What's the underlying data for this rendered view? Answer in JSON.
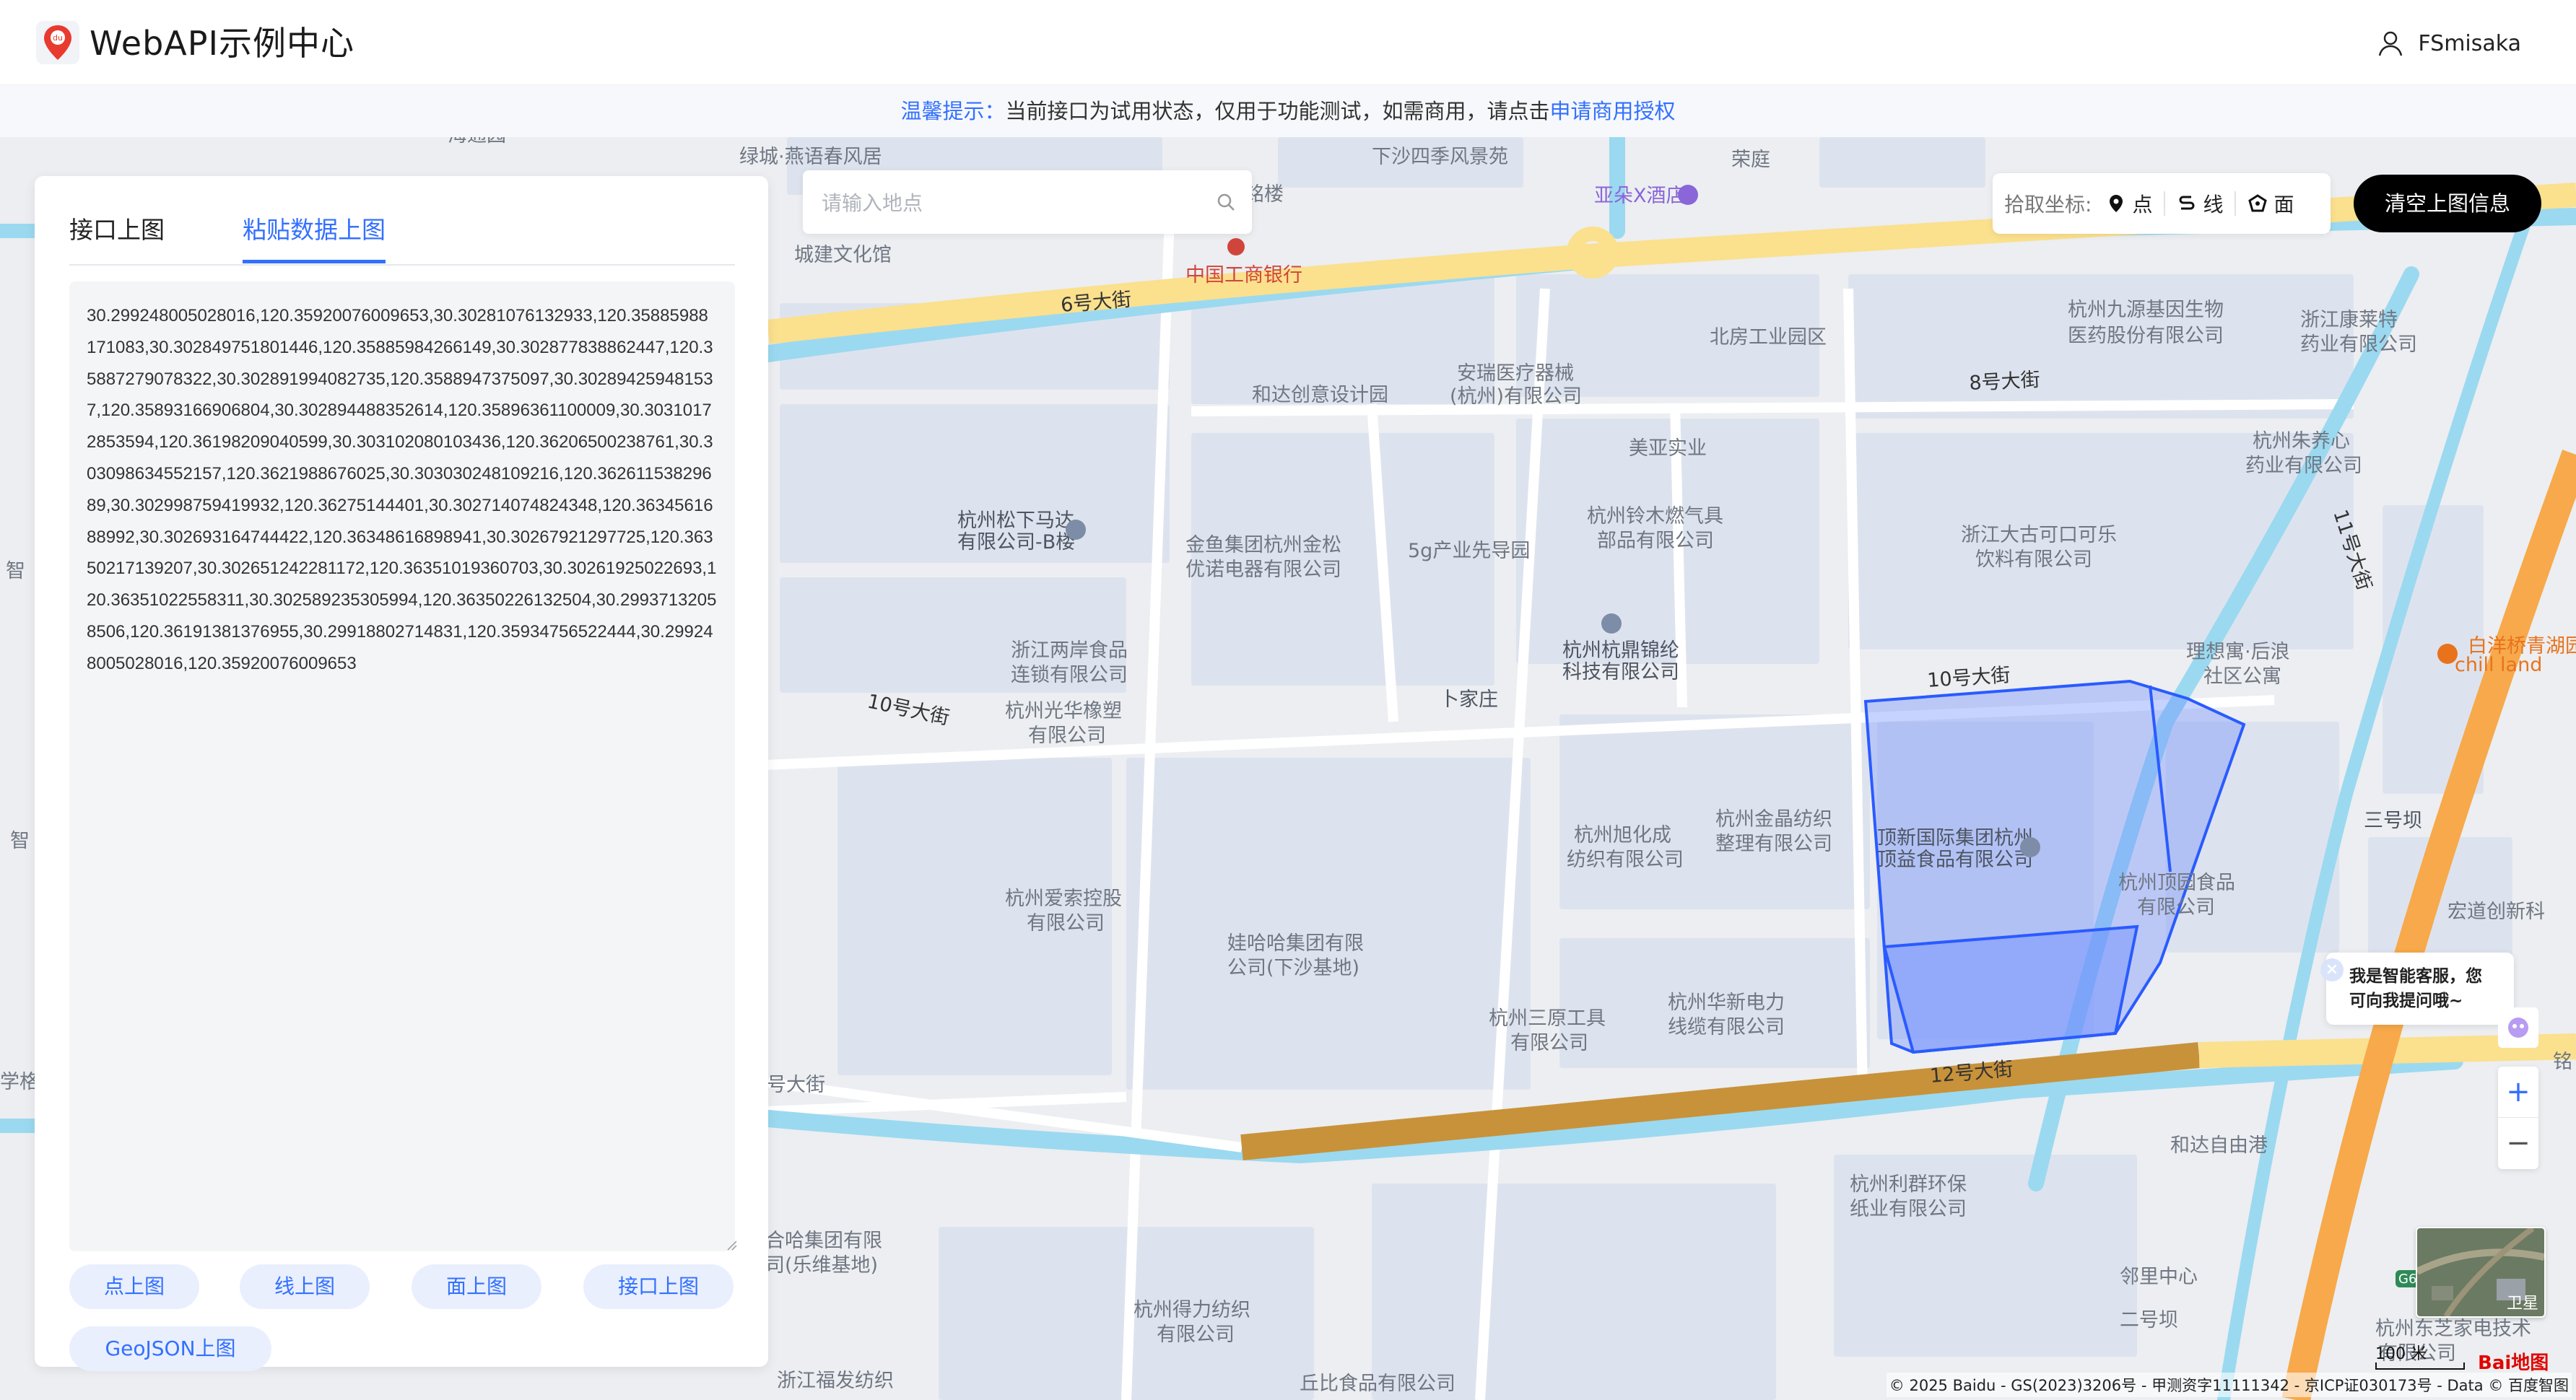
{
  "header": {
    "app_title": "WebAPI示例中心",
    "username": "FSmisaka"
  },
  "notice": {
    "tip_label": "温馨提示：",
    "text": "当前接口为试用状态，仅用于功能测试，如需商用，请点击",
    "link": "申请商用授权"
  },
  "panel": {
    "tabs": [
      "接口上图",
      "粘贴数据上图"
    ],
    "active_tab": "粘贴数据上图",
    "textarea_value": "30.299248005028016,120.35920076009653,30.30281076132933,120.35885988171083,30.302849751801446,120.35885984266149,30.302877838862447,120.35887279078322,30.302891994082735,120.3588947375097,30.30289425948153​7,120.35893166906804,30.302894488352614,120.35896361100009,30.30310172853594,120.36198209040599,30.303102080103436,120.36206500238761,30.303098634552157,120.3621988676025,30.303030248109216,120.36261153829689,30.302998759419932,120.36275144401,30.302714074824348,120.3634561688992,30.302693164744422,120.36348616898941,30.30267921297725,120.36350217139207,30.302651242281172,120.36351019360703,30.30261925022693,120.36351022558311,30.302589235305994,120.36350226132504,30.29937132058506,120.36191381376955,30.29918802714831,120.35934756522444,30.299248005028016,120.35920076009653",
    "buttons": [
      "点上图",
      "线上图",
      "面上图",
      "接口上图",
      "GeoJSON上图"
    ]
  },
  "search": {
    "placeholder": "请输入地点"
  },
  "picker": {
    "label": "拾取坐标:",
    "options": [
      "点",
      "线",
      "面"
    ]
  },
  "clear_button": "清空上图信息",
  "assistant": {
    "line1": "我是智能客服，您",
    "line2": "可向我提问哦~"
  },
  "map": {
    "labels": {
      "l1": "绿城·燕语春风居",
      "l2": "下沙四季风景苑",
      "l3": "荣庭",
      "l4": "之江铭楼",
      "l5": "亚朵X酒店",
      "l6": "城建文化馆",
      "l7": "中国工商银行",
      "l8": "6号大街",
      "l9": "杭州九源基因生物",
      "l10": "医药股份有限公司",
      "l11": "浙江康莱特",
      "l12": "药业有限公司",
      "l13": "北房工业园区",
      "l14": "安瑞医疗器械",
      "l15": "(杭州)有限公司",
      "l16": "和达创意设计园",
      "l17": "8号大街",
      "l18": "美亚实业",
      "l19": "杭州朱养心",
      "l20": "药业有限公司",
      "l21": "杭州松下马达",
      "l22": "有限公司-B楼",
      "l23": "金鱼集团杭州金松",
      "l24": "优诺电器有限公司",
      "l25": "5g产业先导园",
      "l26": "杭州铃木燃气具",
      "l27": "部品有限公司",
      "l28": "浙江大古可口可乐",
      "l29": "饮料有限公司",
      "l30": "杭州杭鼎锦纶",
      "l31": "科技有限公司",
      "l32": "理想寓·后浪",
      "l33": "社区公寓",
      "l34": "白洋桥青湖园",
      "l35": "chill land",
      "l36": "浙江两岸食品",
      "l37": "连锁有限公司",
      "l38": "10号大街",
      "l39": "杭州光华橡塑",
      "l40": "有限公司",
      "l41": "卜家庄",
      "l42": "10号大街",
      "l43": "三号坝",
      "l44": "杭州旭化成",
      "l45": "纺织有限公司",
      "l46": "杭州金晶纺织",
      "l47": "整理有限公司",
      "l48": "顶新国际集团杭州",
      "l49": "顶益食品有限公司",
      "l50": "杭州顶园食品",
      "l51": "有限公司",
      "l52": "宏道创新科",
      "l53": "杭州爱索控股",
      "l54": "有限公司",
      "l55": "娃哈哈集团有限",
      "l56": "公司(下沙基地)",
      "l57": "杭州三原工具",
      "l58": "有限公司",
      "l59": "杭州华新电力",
      "l60": "线缆有限公司",
      "l61": "12号大街",
      "l62": "和达自由港",
      "l63": "杭州利群环保",
      "l64": "纸业有限公司",
      "l65": "合哈集团有限",
      "l66": "司(乐维基地)",
      "l67": "邻里中心",
      "l68": "杭州得力纺织",
      "l69": "有限公司",
      "l70": "二号坝",
      "l71": "杭州东芝家电技术",
      "l72": "有限公司",
      "l73": "浙江福发纺织",
      "l74": "丘比食品有限公司",
      "l75": "11号大街",
      "l76": "智",
      "l77": "智",
      "l78": "铭",
      "l79": "号大街",
      "l80": "学格竹",
      "l81": "海通园",
      "l82": "G60"
    },
    "satellite_label": "卫星",
    "scale_label": "100 米",
    "baidu_logo": "Bai地图",
    "copyright": "© 2025 Baidu - GS(2023)3206号 - 甲测资字11111342 - 京ICP证030173号 - Data © 百度智图"
  },
  "colors": {
    "accent": "#3370ff",
    "polygon_fill": "#5b7fff",
    "river": "#99d9f1",
    "major_road": "#fbe08d",
    "expressway": "#f7a94b",
    "elevated": "#c8923a"
  }
}
